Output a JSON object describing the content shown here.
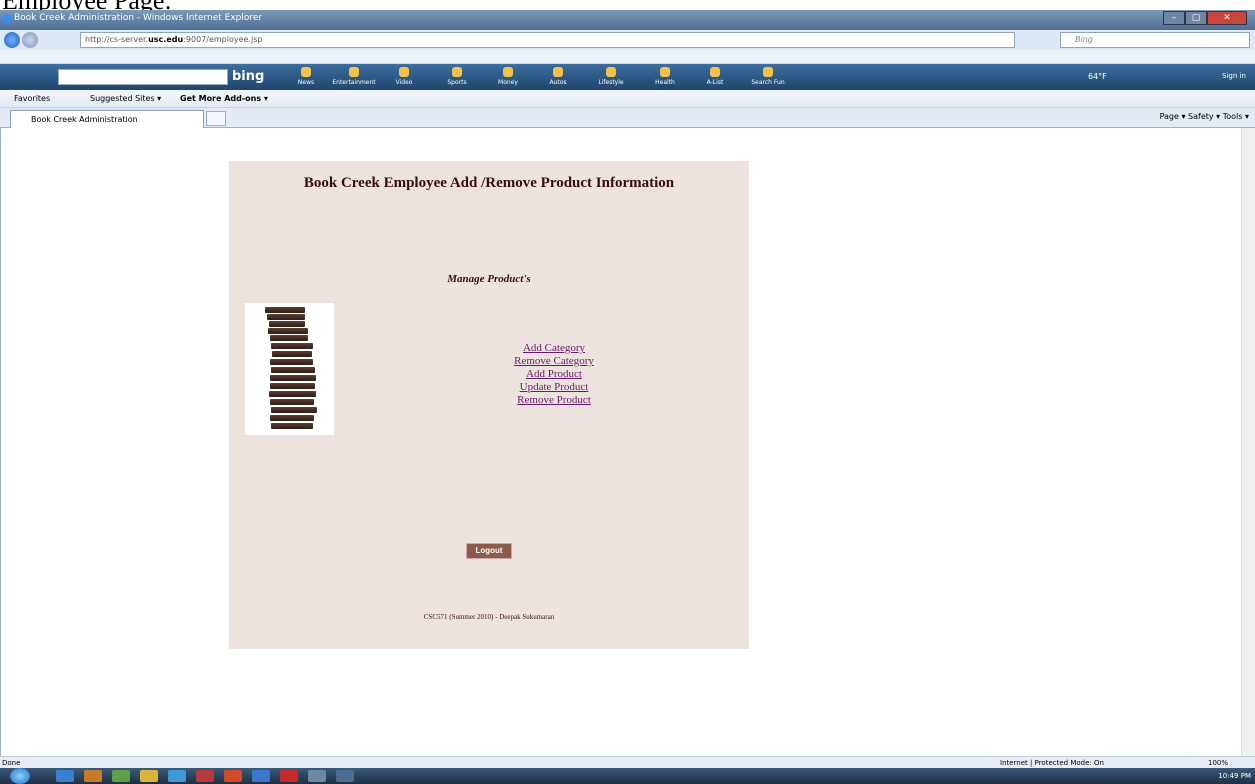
{
  "caption": "Employee Page:",
  "window": {
    "title": "Book Creek Administration - Windows Internet Explorer",
    "min": "–",
    "max": "▢",
    "close": "✕"
  },
  "address": {
    "prefix": "http://cs-server.",
    "host": "usc.edu",
    "suffix": ":9007/employee.jsp",
    "search_placeholder": "Bing"
  },
  "bing": {
    "logo": "bing",
    "items": [
      "News",
      "Entertainment",
      "Video",
      "Sports",
      "Money",
      "Autos",
      "Lifestyle",
      "Health",
      "A-List",
      "Search Fun"
    ],
    "weather": "64°F",
    "signin": "Sign in"
  },
  "favorites": {
    "favorites_label": "Favorites",
    "suggested": "Suggested Sites ▾",
    "addons": "Get More Add-ons ▾"
  },
  "tab": {
    "label": "Book Creek Administration"
  },
  "commands": "Page ▾   Safety ▾   Tools ▾",
  "page": {
    "title": "Book Creek Employee Add /Remove Product Information",
    "manage": "Manage Product's",
    "links": [
      "Add Category",
      "Remove Category",
      "Add Product",
      "Update Product",
      "Remove Product"
    ],
    "logout": "Logout",
    "footer": "CSC571 (Summer 2010) - Deepak Sukumaran"
  },
  "status": {
    "left": "Done",
    "zone": "Internet | Protected Mode: On",
    "zoom": "100%"
  },
  "clock": "10:49 PM",
  "colors": {
    "panel": "#ede3de",
    "title": "#3a0d0d",
    "link": "#6a1a6a",
    "logout_bg": "#8c5a48"
  }
}
